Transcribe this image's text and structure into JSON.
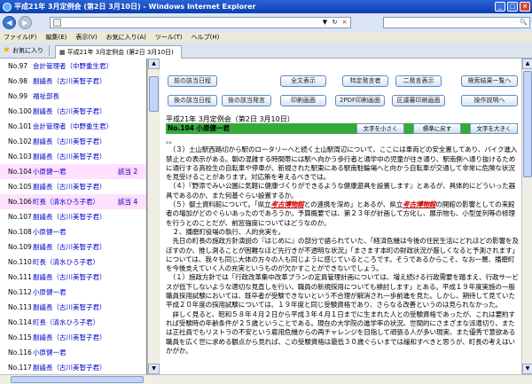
{
  "window": {
    "title": "平成21年 3月定例会 (第2日 3月10日) - Windows Internet Explorer",
    "min": "_",
    "max": "□",
    "close": "×"
  },
  "toolbar": {
    "back": "◀",
    "forward": "▶",
    "refresh": "↻",
    "stop": "×"
  },
  "address": {
    "value": ""
  },
  "menu": [
    "ファイル(F)",
    "編集(E)",
    "表示(V)",
    "お気に入り(A)",
    "ツール(T)",
    "ヘルプ(H)"
  ],
  "tabs": {
    "favorites": "お気に入り",
    "tab_label": "平成21年 3月定例会 (第2日 3月10日)"
  },
  "left_list": [
    {
      "no": "No.97",
      "speaker": "会計管理者（中野重生君）",
      "label": ""
    },
    {
      "no": "No.98",
      "speaker": "副議長（古川美智子君）",
      "label": ""
    },
    {
      "no": "No.99",
      "speaker": "福祉部長",
      "label": ""
    },
    {
      "no": "No.100",
      "speaker": "副議長（古川美智子君）",
      "label": ""
    },
    {
      "no": "No.101",
      "speaker": "会計管理者（中野重生君）",
      "label": ""
    },
    {
      "no": "No.102",
      "speaker": "副議長（古川美智子君）",
      "label": ""
    },
    {
      "no": "No.103",
      "speaker": "副議長（古川美智子君）",
      "label": ""
    },
    {
      "no": "No.104",
      "speaker": "小原健一君",
      "label": "該当 2",
      "hl": true
    },
    {
      "no": "No.105",
      "speaker": "副議長（古川美智子君）",
      "label": ""
    },
    {
      "no": "No.106",
      "speaker": "町長（清水ひろ子君）",
      "label": "該当 4",
      "hl": true
    },
    {
      "no": "No.107",
      "speaker": "副議長（古川美智子君）",
      "label": ""
    },
    {
      "no": "No.108",
      "speaker": "小原健一君",
      "label": ""
    },
    {
      "no": "No.109",
      "speaker": "副議長（古川美智子君）",
      "label": ""
    },
    {
      "no": "No.110",
      "speaker": "町長（清水ひろ子君）",
      "label": ""
    },
    {
      "no": "No.111",
      "speaker": "副議長（古川美智子君）",
      "label": ""
    },
    {
      "no": "No.112",
      "speaker": "小原健一君",
      "label": ""
    },
    {
      "no": "No.113",
      "speaker": "副議長（古川美智子君）",
      "label": ""
    },
    {
      "no": "No.114",
      "speaker": "町長（清水ひろ子君）",
      "label": ""
    },
    {
      "no": "No.115",
      "speaker": "副議長（古川美智子君）",
      "label": ""
    },
    {
      "no": "No.116",
      "speaker": "小原健一君",
      "label": ""
    },
    {
      "no": "No.117",
      "speaker": "副議長（古川美智子君）",
      "label": ""
    },
    {
      "no": "No.118",
      "speaker": "町長（清水ひろ子君）",
      "label": ""
    }
  ],
  "buttons": {
    "prev_hit": "前の該当日程",
    "all_display": "全文表示",
    "special_speaker": "特定発言者",
    "two_speaker": "二発言表示",
    "search_list": "検索結果一覧へ",
    "next_date": "後の該当日程",
    "next_speaker": "後の該当発言",
    "print_display": "印刷画面",
    "pdf_print": "2PDF印刷画面",
    "council_print": "区議審印刷画面",
    "help": "操作説明へ"
  },
  "meeting_title": "平成21年 3月定例会（第2日 3月10日）",
  "speaker": {
    "label": "No.104 小原健一君",
    "text_small": "文字を小さく",
    "text_reset": "標準に戻す",
    "text_large": "文字を大きく"
  },
  "content": [
    "。。",
    "　（３）土山駅西路切から駅のロータリーへと続く土山駅周辺について、ここには車両どの安全置してあり、バイク進入禁止との表示がある。朝の混雑する時間帯には駅へ向かう歩行者と通学中の児童が往き通り、駅南側へ通り抜けるために通行する高校生の自転車や停車が、新規された駅東にある駅南駐輪場へと向かう自転車が交通して非常に危険な状況を見受けることがあります。対応策を考えるべきでは。",
    "　（４）『野添でみい公園に気軽に健康づくりができるような健康遊具を設置します』とあるが、具体的にどういった器具であるのか、また何基ぐらい設置するか。",
    "　（５）御土資料館について。「県立考古博物館との連携を深め」とあるが、県立考古博物館の開館の影響としての来館者の増加がどのぐらいあったのであろうか。予算概要では、第２３年が計画して方化し、展示物も、小型並列等の修理を行うとのことだが、前窓強度についてはどうなのか。",
    "　２、播磨町役場の執行、人的充実を。",
    "　先日の町長の施政方針演説の『はじめに』の部分で語られていた、「経済危機は今後の住民生活にどれほどの影響を及ぼすのか、推し測ることが困難なほど先行きが不透明な状況」「まさます本町の財政状況が厳しくなると予測されます」については、我々も同じ大体の方々の人も同じように感じているところです。そうであるからこそ、なお一層、播磨町を今後支えていく人の充実というものが欠かすことができないでしょう。",
    "　（１）施政方針では「行政改革集中改革プランの定員管理計画については、増え続ける行政需要を踏まえ、行政サービスが低下しないような適切な見直しを行い、職員の新規採用についても検討します」とある。平成１９年度実施の一般職員採用試験においては、既卒者が受験できないという不合理が解消され一歩前進を見た。しかし、期待して見ていた平成２０年度の採用試験については、１９年度と同じ受験資格であり、さらなる改善というのは見られなかった。",
    "　詳しく見ると、昭和５８年４月２日から平成３年４月１日までに生まれた人との受験資格であったが、これは要約すれば受験時の年齢条件が２５歳ということである。現在の大学院の進学率の状況、世間的にさまざまな派遣切り、または正社員でもリストラの不安という雇用危機からの再チャレンジを目指して頑張る人が多い現実、また優秀で意欲ある職員を広く世に求める観点から見れば、この受験資格は最低３０歳ぐらいまでは緩和すべきと思うが、町長の考えはいかがか。"
  ]
}
